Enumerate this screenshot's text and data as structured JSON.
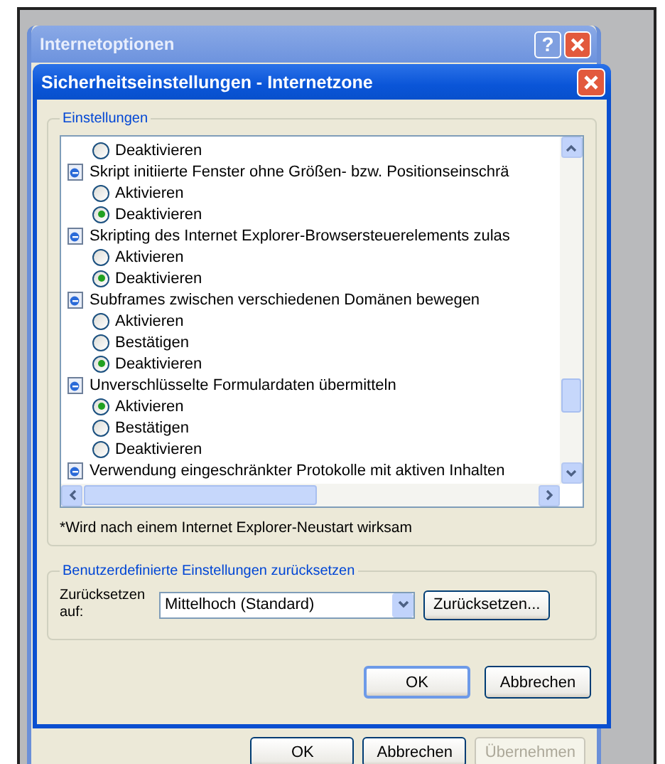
{
  "background_window": {
    "title": "Internetoptionen",
    "help_button": "?",
    "buttons": [
      {
        "label": "OK",
        "disabled": false
      },
      {
        "label": "Abbrechen",
        "disabled": false
      },
      {
        "label": "Übernehmen",
        "disabled": true
      }
    ]
  },
  "dialog": {
    "title": "Sicherheitseinstellungen - Internetzone",
    "settings_group": {
      "title": "Einstellungen",
      "items": [
        {
          "kind": "option",
          "label": "Deaktivieren",
          "selected": false
        },
        {
          "kind": "setting",
          "label": "Skript initiierte Fenster ohne Größen- bzw. Positionseinschrä",
          "options": [
            {
              "label": "Aktivieren",
              "selected": false
            },
            {
              "label": "Deaktivieren",
              "selected": true
            }
          ]
        },
        {
          "kind": "setting",
          "label": "Skripting des Internet Explorer-Browsersteuerelements zulas",
          "options": [
            {
              "label": "Aktivieren",
              "selected": false
            },
            {
              "label": "Deaktivieren",
              "selected": true
            }
          ]
        },
        {
          "kind": "setting",
          "label": "Subframes zwischen verschiedenen Domänen bewegen",
          "options": [
            {
              "label": "Aktivieren",
              "selected": false
            },
            {
              "label": "Bestätigen",
              "selected": false
            },
            {
              "label": "Deaktivieren",
              "selected": true
            }
          ]
        },
        {
          "kind": "setting",
          "label": "Unverschlüsselte Formulardaten übermitteln",
          "options": [
            {
              "label": "Aktivieren",
              "selected": true
            },
            {
              "label": "Bestätigen",
              "selected": false
            },
            {
              "label": "Deaktivieren",
              "selected": false
            }
          ]
        },
        {
          "kind": "setting",
          "label": "Verwendung eingeschränkter Protokolle mit aktiven Inhalten"
        }
      ]
    },
    "note": "*Wird nach einem Internet Explorer-Neustart wirksam",
    "reset_group": {
      "title": "Benutzerdefinierte Einstellungen zurücksetzen",
      "label": "Zurücksetzen auf:",
      "value": "Mittelhoch (Standard)",
      "button": "Zurücksetzen..."
    },
    "buttons": [
      "OK",
      "Abbrechen"
    ]
  }
}
